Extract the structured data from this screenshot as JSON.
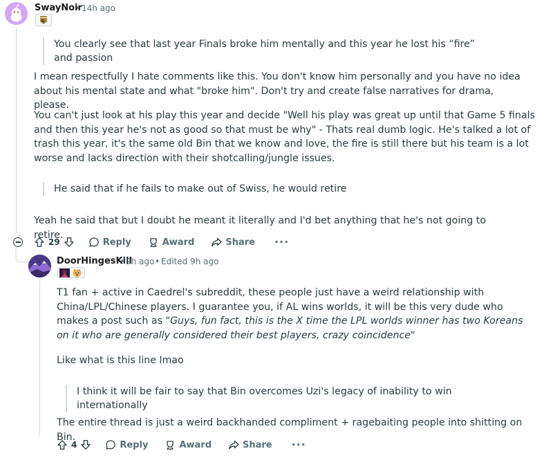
{
  "comment_1": {
    "username": "SwayNoir",
    "time_separator": "•",
    "time": "14h ago",
    "flair_icon": "gen-g-badge-icon",
    "quote_1": "You clearly see that last year Finals broke him mentally and this year he lost his “fire” and passion",
    "para_1": "I mean respectfully I hate comments like this. You don't know him personally and you have no idea about his mental state and what \"broke him\". Don't try and create false narratives for drama, please.",
    "para_2": "You can't just look at his play this year and decide \"Well his play was great up until that Game 5 finals and then this year he's not as good so that must be why\" - Thats real dumb logic. He's talked a lot of trash this year, it's the same old Bin that we know and love, the fire is still there but his team is a lot worse and lacks direction with their shotcalling/jungle issues.",
    "quote_2": "He said that if he fails to make out of Swiss, he would retire",
    "para_3": "Yeah he said that but I doubt he meant it literally and I'd bet anything that he's not going to retire.",
    "actions": {
      "votes": "29",
      "reply": "Reply",
      "award": "Award",
      "share": "Share",
      "more": "···"
    }
  },
  "comment_2": {
    "username": "DoorHingesKill",
    "time_separator": "•",
    "time": "9h ago",
    "edited_separator": "•",
    "edited": "Edited 9h ago",
    "flair_icons": [
      "champion-portrait-icon",
      "doge-emote-icon"
    ],
    "para_1_plain": "T1 fan + active in Caedrel's subreddit, these people just have a weird relationship with China/LPL/Chinese players. I guarantee you, if AL wins worlds, it will be this very dude who makes a post such as ",
    "para_1_italic": "\"Guys, fun fact, this is the X time the LPL worlds winner has two Koreans on it who are generally considered their best players, crazy coincidence\"",
    "para_2": "Like what is this line lmao",
    "quote_1": "I think it will be fair to say that Bin overcomes Uzi's legacy of inability to win internationally",
    "para_3": "The entire thread is just a weird backhanded compliment + ragebaiting people into shitting on Bin.",
    "actions": {
      "votes": "4",
      "reply": "Reply",
      "award": "Award",
      "share": "Share",
      "more": "···"
    }
  },
  "colors": {
    "text": "#2a3c42",
    "meta": "#576f76",
    "thread_line": "#d4d7d9",
    "avatar_1_bg": "#d3a6f5"
  }
}
